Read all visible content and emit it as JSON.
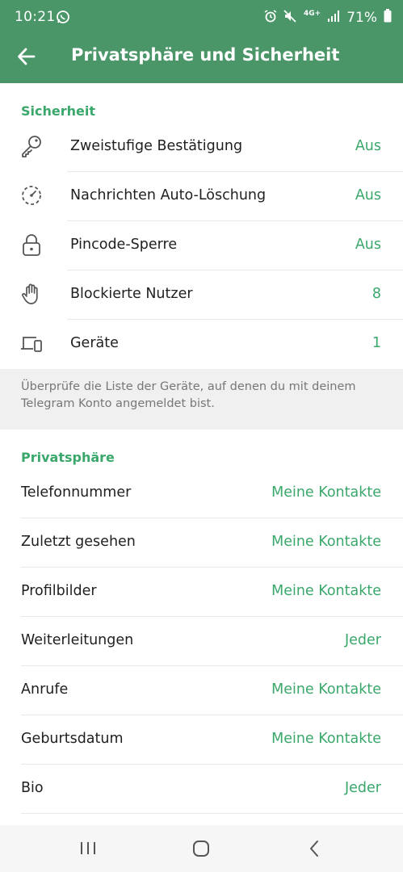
{
  "status_bar": {
    "time": "10:21",
    "network": "4G+",
    "battery": "71%"
  },
  "header": {
    "title": "Privatsphäre und Sicherheit"
  },
  "security": {
    "title": "Sicherheit",
    "items": [
      {
        "label": "Zweistufige Bestätigung",
        "value": "Aus",
        "icon": "key-icon"
      },
      {
        "label": "Nachrichten Auto-Löschung",
        "value": "Aus",
        "icon": "timer-icon"
      },
      {
        "label": "Pincode-Sperre",
        "value": "Aus",
        "icon": "lock-icon"
      },
      {
        "label": "Blockierte Nutzer",
        "value": "8",
        "icon": "hand-icon"
      },
      {
        "label": "Geräte",
        "value": "1",
        "icon": "devices-icon"
      }
    ],
    "info": "Überprüfe die Liste der Geräte, auf denen du mit deinem Telegram Konto angemeldet bist."
  },
  "privacy": {
    "title": "Privatsphäre",
    "items": [
      {
        "label": "Telefonnummer",
        "value": "Meine Kontakte"
      },
      {
        "label": "Zuletzt gesehen",
        "value": "Meine Kontakte"
      },
      {
        "label": "Profilbilder",
        "value": "Meine Kontakte"
      },
      {
        "label": "Weiterleitungen",
        "value": "Jeder"
      },
      {
        "label": "Anrufe",
        "value": "Meine Kontakte"
      },
      {
        "label": "Geburtsdatum",
        "value": "Meine Kontakte"
      },
      {
        "label": "Bio",
        "value": "Jeder"
      }
    ]
  },
  "colors": {
    "header": "#4a9668",
    "accent": "#3aa76b"
  }
}
